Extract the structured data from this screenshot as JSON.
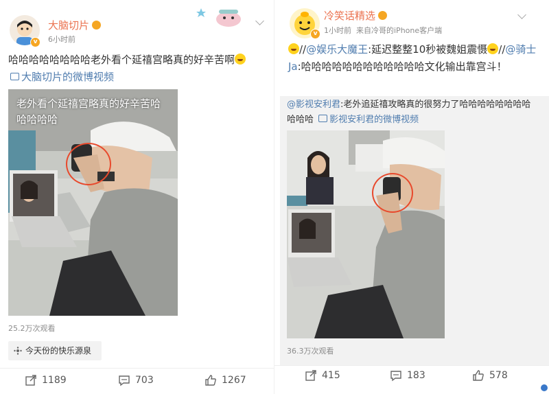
{
  "left_post": {
    "username": "大脑切片",
    "timestamp": "6小时前",
    "text": "哈哈哈哈哈哈哈哈老外看个延禧宫略真的好辛苦啊",
    "video_link": "大脑切片的微博视频",
    "video_caption": "老外看个延禧宫略真的好辛苦哈哈哈哈哈",
    "views": "25.2万次观看",
    "topic": "今天份的快乐源泉",
    "reposts": "1189",
    "comments": "703",
    "likes": "1267"
  },
  "right_post": {
    "username": "冷笑话精选",
    "timestamp": "1小时前",
    "source": "来自冷哥的iPhone客户端",
    "text_prefix": "//",
    "mention_1": "@娱乐大魔王",
    "text_1": ":延迟整整10秒被魏姐震慑",
    "text_2": "//",
    "mention_2": "@骑士Ja",
    "text_3": ":哈哈哈哈哈哈哈哈哈哈哈哈文化输出靠宫斗！",
    "repost_mention": "@影视安利君",
    "repost_text": ":老外追延禧攻略真的很努力了哈哈哈哈哈哈哈哈哈哈哈",
    "repost_video_link": "影视安利君的微博视频",
    "views": "36.3万次观看",
    "reposts": "415",
    "comments": "183",
    "likes": "578"
  },
  "colors": {
    "accent_orange": "#eb7350",
    "link_blue": "#507daf",
    "highlight_circle": "#e8492c"
  }
}
